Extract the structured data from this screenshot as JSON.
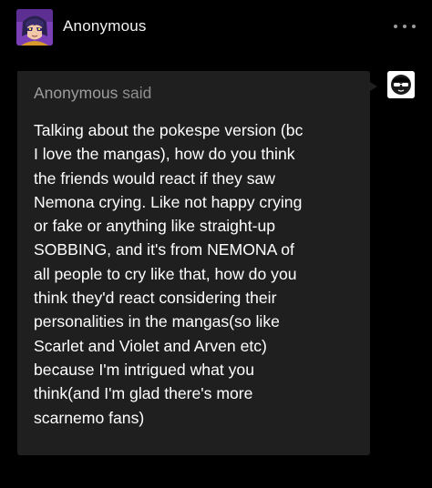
{
  "post": {
    "author": "Anonymous",
    "author_avatar_icon": "anime-character-avatar-icon",
    "more_options_icon": "ellipsis-horizontal-icon"
  },
  "ask": {
    "asker_name": "Anonymous",
    "said_label": " said",
    "asker_avatar_icon": "anonymous-sunglasses-icon",
    "body": "Talking about the pokespe version (bc\nI love the mangas), how do you think\nthe friends would react if they saw\nNemona crying. Like not happy crying\nor fake or anything like straight-up\nSOBBING, and it's from NEMONA of\nall people to cry like that, how do you\nthink they'd react considering their\npersonalities in the mangas(so like\nScarlet and Violet and Arven etc)\nbecause I'm intrigued what you\nthink(and I'm glad there's more\nscarnemo fans)"
  },
  "colors": {
    "page_background": "#000000",
    "card_background": "#1f1f1f",
    "muted_text": "#8e8e8e",
    "avatar_purple": "#7b3fb6"
  }
}
